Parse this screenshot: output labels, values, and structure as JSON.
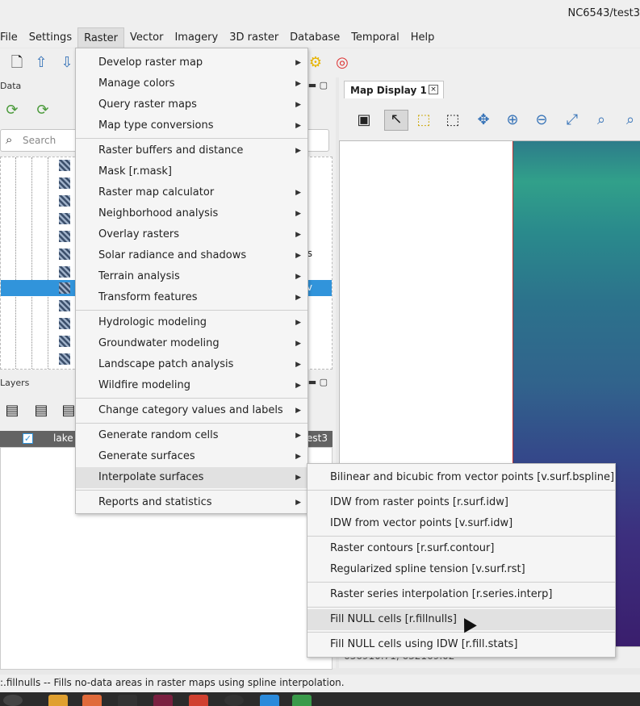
{
  "window": {
    "title": "NC6543/test3"
  },
  "menubar": [
    "File",
    "Settings",
    "Raster",
    "Vector",
    "Imagery",
    "3D raster",
    "Database",
    "Temporal",
    "Help"
  ],
  "left_panel": {
    "data_header": "Data",
    "search_placeholder": "Search",
    "tree_right_texts": [
      "nes",
      "v"
    ],
    "layers_header": "Layers",
    "layer_name": "lake",
    "layer_right": "est3"
  },
  "map_display": {
    "tab_label": "Map Display 1",
    "close_glyph": "×",
    "coords": "636910.71, 632169.02"
  },
  "status_bar": ":.fillnulls -- Fills no-data areas in raster maps using spline interpolation.",
  "raster_menu": {
    "groups": [
      [
        {
          "label": "Develop raster map",
          "submenu": true
        },
        {
          "label": "Manage colors",
          "submenu": true
        },
        {
          "label": "Query raster maps",
          "submenu": true
        },
        {
          "label": "Map type conversions",
          "submenu": true
        }
      ],
      [
        {
          "label": "Raster buffers and distance",
          "submenu": true
        },
        {
          "label": "Mask  [r.mask]",
          "submenu": false
        },
        {
          "label": "Raster map calculator",
          "submenu": true
        },
        {
          "label": "Neighborhood analysis",
          "submenu": true
        },
        {
          "label": "Overlay rasters",
          "submenu": true
        },
        {
          "label": "Solar radiance and shadows",
          "submenu": true
        },
        {
          "label": "Terrain analysis",
          "submenu": true
        },
        {
          "label": "Transform features",
          "submenu": true
        }
      ],
      [
        {
          "label": "Hydrologic modeling",
          "submenu": true
        },
        {
          "label": "Groundwater modeling",
          "submenu": true
        },
        {
          "label": "Landscape patch analysis",
          "submenu": true
        },
        {
          "label": "Wildfire modeling",
          "submenu": true
        }
      ],
      [
        {
          "label": "Change category values and labels",
          "submenu": true
        }
      ],
      [
        {
          "label": "Generate random cells",
          "submenu": true
        },
        {
          "label": "Generate surfaces",
          "submenu": true
        },
        {
          "label": "Interpolate surfaces",
          "submenu": true,
          "highlighted": true
        }
      ],
      [
        {
          "label": "Reports and statistics",
          "submenu": true
        }
      ]
    ]
  },
  "interpolate_submenu": {
    "groups": [
      [
        {
          "label": "Bilinear and bicubic from vector points  [v.surf.bspline]"
        }
      ],
      [
        {
          "label": "IDW from raster points  [r.surf.idw]"
        },
        {
          "label": "IDW from vector points  [v.surf.idw]"
        }
      ],
      [
        {
          "label": "Raster contours  [r.surf.contour]"
        },
        {
          "label": "Regularized spline tension  [v.surf.rst]"
        }
      ],
      [
        {
          "label": "Raster series interpolation  [r.series.interp]"
        }
      ],
      [
        {
          "label": "Fill NULL cells  [r.fillnulls]",
          "highlighted": true
        }
      ],
      [
        {
          "label": "Fill NULL cells using IDW  [r.fill.stats]"
        }
      ]
    ]
  },
  "colors": {
    "accent": "#3194db",
    "map_top": "#31a08a",
    "map_bottom": "#3a1e6d"
  },
  "icons": [
    "new-map-icon",
    "upload-icon",
    "download-icon",
    "settings-gear-icon",
    "help-lifebuoy-icon",
    "refresh-icon",
    "search-icon",
    "pointer-icon",
    "zoom-in-icon",
    "zoom-out-icon",
    "pan-icon"
  ]
}
